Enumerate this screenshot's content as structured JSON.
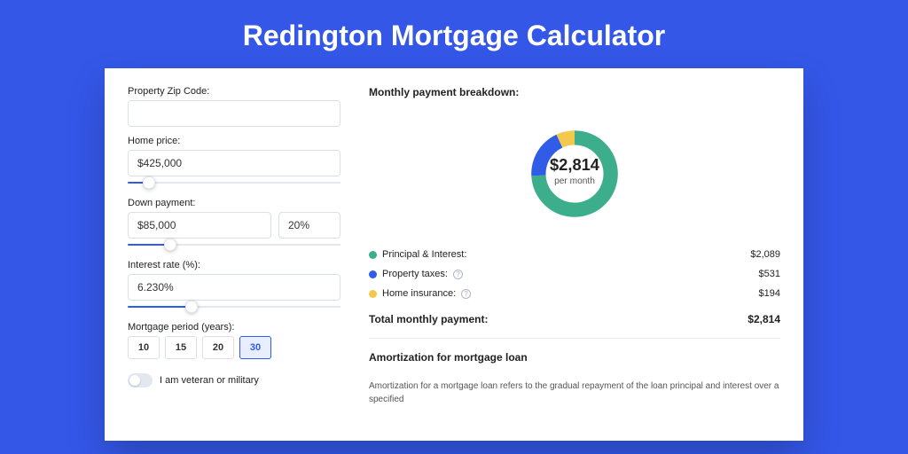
{
  "title": "Redington Mortgage Calculator",
  "form": {
    "zip_label": "Property Zip Code:",
    "zip_value": "",
    "price_label": "Home price:",
    "price_value": "$425,000",
    "price_slider_pct": 10,
    "down_label": "Down payment:",
    "down_value": "$85,000",
    "down_pct_value": "20%",
    "down_slider_pct": 20,
    "rate_label": "Interest rate (%):",
    "rate_value": "6.230%",
    "rate_slider_pct": 30,
    "period_label": "Mortgage period (years):",
    "periods": [
      "10",
      "15",
      "20",
      "30"
    ],
    "period_selected": "30",
    "veteran_label": "I am veteran or military",
    "veteran_on": false
  },
  "breakdown": {
    "title": "Monthly payment breakdown:",
    "amount": "$2,814",
    "sub": "per month",
    "rows": [
      {
        "label": "Principal & Interest:",
        "value": "$2,089",
        "color": "#3DAE8B",
        "help": false
      },
      {
        "label": "Property taxes:",
        "value": "$531",
        "color": "#305CE8",
        "help": true
      },
      {
        "label": "Home insurance:",
        "value": "$194",
        "color": "#F2C94C",
        "help": true
      }
    ],
    "total_label": "Total monthly payment:",
    "total_value": "$2,814"
  },
  "amort": {
    "title": "Amortization for mortgage loan",
    "text": "Amortization for a mortgage loan refers to the gradual repayment of the loan principal and interest over a specified"
  },
  "chart_data": {
    "type": "pie",
    "title": "Monthly payment breakdown",
    "series": [
      {
        "name": "Principal & Interest",
        "value": 2089,
        "color": "#3DAE8B"
      },
      {
        "name": "Property taxes",
        "value": 531,
        "color": "#305CE8"
      },
      {
        "name": "Home insurance",
        "value": 194,
        "color": "#F2C94C"
      }
    ],
    "total": 2814
  }
}
